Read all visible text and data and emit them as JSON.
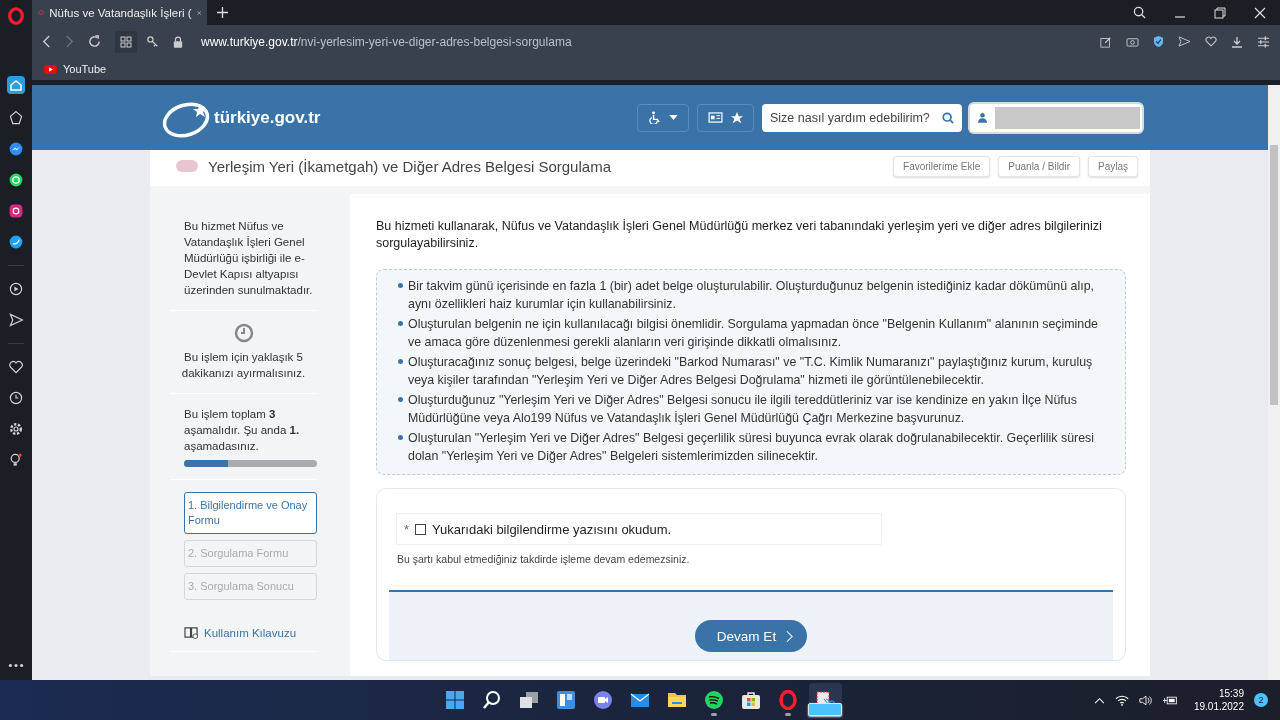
{
  "browser": {
    "tab_title": "Nüfus ve Vatandaşlık İşleri (",
    "address": {
      "domain": "www.turkiye.gov.tr",
      "path": "/nvi-yerlesim-yeri-ve-diger-adres-belgesi-sorgulama"
    },
    "bookmarks": [
      "YouTube"
    ]
  },
  "header": {
    "logo": "türkiye.gov.tr",
    "search": {
      "placeholder": "Size nasıl yardım edebilirim?"
    }
  },
  "page": {
    "title": "Yerleşim Yeri (İkametgah) ve Diğer Adres Belgesi Sorgulama",
    "actions": [
      "Favorilerime Ekle",
      "Puanla / Bildir",
      "Paylaş"
    ]
  },
  "sidebar": {
    "intro": "Bu hizmet Nüfus ve Vatandaşlık İşleri Genel Müdürlüğü işbirliği ile e-Devlet Kapısı altyapısı üzerinden sunulmaktadır.",
    "duration": "Bu işlem için yaklaşık 5 dakikanızı ayırmalısınız.",
    "progress": {
      "text": "Bu işlem toplam **3** aşamalıdır. Şu anda **1.** aşamadasınız.",
      "level": 0.33
    },
    "steps": [
      {
        "label": "1. Bilgilendirme ve Onay Formu",
        "selected": true
      },
      {
        "label": "2. Sorgulama Formu",
        "selected": false
      },
      {
        "label": "3. Sorgulama Sonucu",
        "selected": false
      }
    ],
    "guide": "Kullanım Kılavuzu"
  },
  "main": {
    "intro": "Bu hizmeti kullanarak, Nüfus ve Vatandaşlık İşleri Genel Müdürlüğü merkez veri tabanındaki yerleşim yeri ve diğer adres bilgilerinizi sorgulayabilirsiniz.",
    "notes": [
      "Bir takvim günü içerisinde en fazla 1 (bir) adet belge oluşturulabilir. Oluşturduğunuz belgenin istediğiniz kadar dökümünü alıp, aynı özellikleri haiz kurumlar için kullanabilirsiniz.",
      "Oluşturulan belgenin ne için kullanılacağı bilgisi önemlidir. Sorgulama yapmadan önce \"Belgenin Kullanım\" alanının seçiminde ve amaca göre düzenlenmesi gerekli alanların veri girişinde dikkatli olmalısınız.",
      "Oluşturacağınız sonuç belgesi, belge üzerindeki \"Barkod Numarası\" ve \"T.C. Kimlik Numaranızı\" paylaştığınız kurum, kuruluş veya kişiler tarafından \"Yerleşim Yeri ve Diğer Adres Belgesi Doğrulama\" hizmeti ile görüntülenebilecektir.",
      "Oluşturduğunuz \"Yerleşim Yeri ve Diğer Adres\" Belgesi sonucu ile ilgili tereddütleriniz var ise kendinize en yakın İlçe Nüfus Müdürlüğüne veya Alo199 Nüfus ve Vatandaşlık İşleri Genel Müdürlüğü Çağrı Merkezine başvurunuz.",
      "Oluşturulan \"Yerleşim Yeri ve Diğer Adres\" Belgesi geçerlilik süresi buyunca evrak olarak doğrulanabilecektir. Geçerlilik süresi dolan \"Yerleşim Yeri ve Diğer Adres\" Belgeleri sistemlerimizden silinecektir."
    ],
    "consent": {
      "required_mark": "*",
      "label": "Yukarıdaki bilgilendirme yazısını okudum.",
      "checked": false
    },
    "consent_note": "Bu şartı kabul etmediğiniz takdirde işleme devam edemezsiniz.",
    "submit": "Devam Et"
  },
  "taskbar": {
    "apps": [
      {
        "kind": "start",
        "running": false,
        "active": false
      },
      {
        "kind": "search",
        "running": false,
        "active": false
      },
      {
        "kind": "taskview",
        "running": false,
        "active": false
      },
      {
        "kind": "widgets",
        "running": false,
        "active": false
      },
      {
        "kind": "chat",
        "running": false,
        "active": false
      },
      {
        "kind": "mail",
        "running": false,
        "active": false
      },
      {
        "kind": "folder",
        "running": false,
        "active": false
      },
      {
        "kind": "music",
        "running": true,
        "active": false
      },
      {
        "kind": "store",
        "running": false,
        "active": false
      },
      {
        "kind": "browser",
        "running": true,
        "active": false
      },
      {
        "kind": "snip",
        "running": true,
        "active": true
      }
    ],
    "time": "15:39",
    "date": "19.01.2022",
    "notifications": "2"
  }
}
